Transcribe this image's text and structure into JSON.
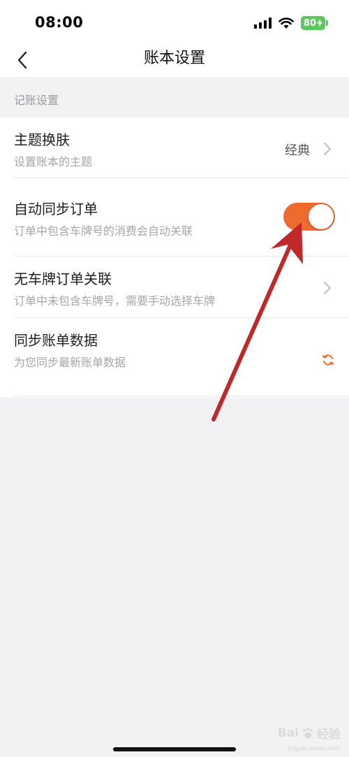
{
  "status_bar": {
    "time": "08:00",
    "battery_level": "80",
    "icons": [
      "signal-icon",
      "wifi-icon",
      "battery-icon",
      "charging-bolt-icon"
    ]
  },
  "nav": {
    "title": "账本设置",
    "back_icon": "chevron-left-icon"
  },
  "section": {
    "header": "记账设置"
  },
  "settings": [
    {
      "title": "主题换肤",
      "subtitle": "设置账本的主题",
      "value": "经典",
      "control": "chevron-right-icon"
    },
    {
      "title": "自动同步订单",
      "subtitle": "订单中包含车牌号的消费会自动关联",
      "control": "toggle",
      "toggle_on": true
    },
    {
      "title": "无车牌订单关联",
      "subtitle": "订单中未包含车牌号，需要手动选择车牌",
      "control": "chevron-right-icon"
    },
    {
      "title": "同步账单数据",
      "subtitle": "为您同步最新账单数据",
      "control": "refresh-icon"
    }
  ],
  "colors": {
    "accent": "#ef6a2f",
    "background": "#f2f2f4",
    "arrow": "#c0282a"
  },
  "watermark": {
    "brand": "Bai",
    "suffix": "经验",
    "url": "jingyan.baidu.com"
  }
}
